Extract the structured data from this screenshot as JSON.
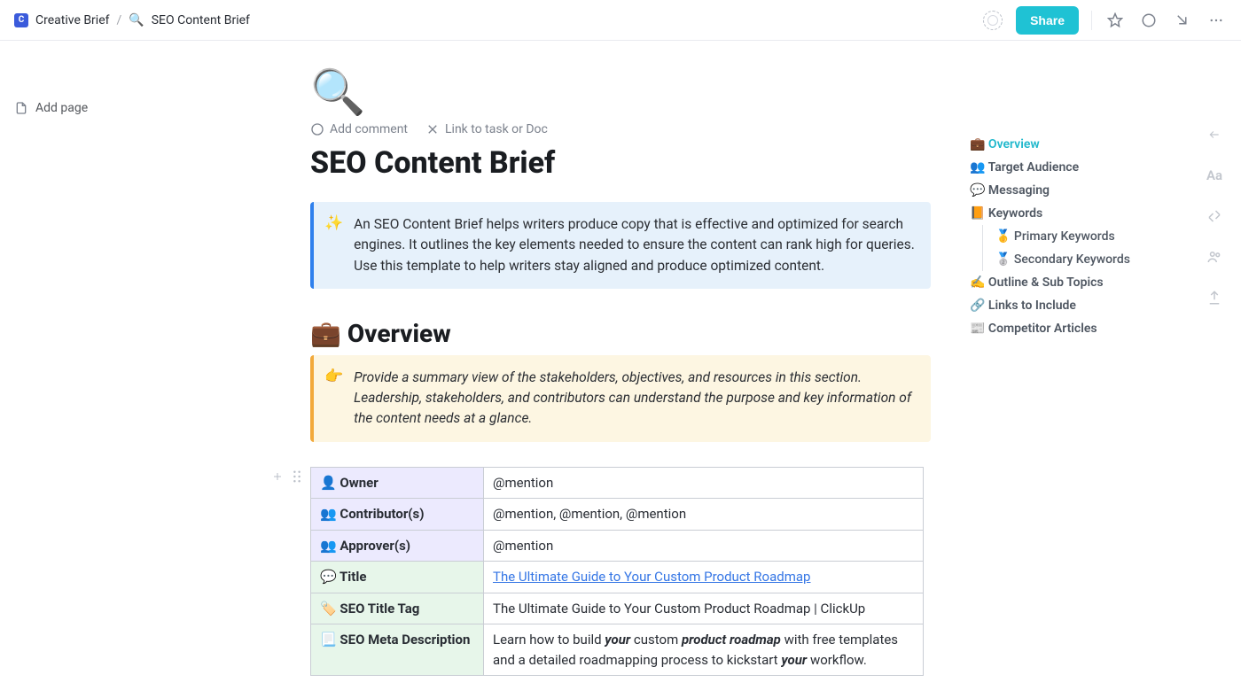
{
  "breadcrumb": {
    "workspace_initial": "C",
    "workspace": "Creative Brief",
    "separator": "/",
    "page_icon": "🔍",
    "page_name": "SEO Content Brief"
  },
  "topbar": {
    "share_label": "Share"
  },
  "left_rail": {
    "add_page_label": "Add page"
  },
  "page": {
    "icon": "🔍",
    "add_comment_label": "Add comment",
    "link_label": "Link to task or Doc",
    "title": "SEO Content Brief",
    "intro_callout_icon": "✨",
    "intro_callout": "An SEO Content Brief helps writers produce copy that is effective and optimized for search engines. It outlines the key elements needed to ensure the content can rank high for queries. Use this template to help writers stay aligned and produce optimized content.",
    "overview_heading_icon": "💼",
    "overview_heading": "Overview",
    "overview_callout_icon": "👉",
    "overview_callout": "Provide a summary view of the stakeholders, objectives, and resources in this section. Leadership, stakeholders, and contributors can understand the purpose and key information of the content needs at a glance."
  },
  "table": {
    "rows": [
      {
        "icon": "👤",
        "label": "Owner",
        "value": "@mention",
        "group": "purple"
      },
      {
        "icon": "👥",
        "label": "Contributor(s)",
        "value": "@mention, @mention, @mention",
        "group": "purple"
      },
      {
        "icon": "👥",
        "label": "Approver(s)",
        "value": "@mention",
        "group": "purple"
      },
      {
        "icon": "💬",
        "label": "Title",
        "value_link": "The Ultimate Guide to Your Custom Product Roadmap",
        "group": "green"
      },
      {
        "icon": "🏷️",
        "label": "SEO Title Tag",
        "value": "The Ultimate Guide to Your Custom Product Roadmap | ClickUp",
        "group": "green"
      },
      {
        "icon": "📃",
        "label": "SEO Meta Description",
        "value_parts": [
          {
            "t": "Learn how to build "
          },
          {
            "t": "your",
            "i": true,
            "b": true
          },
          {
            "t": " custom "
          },
          {
            "t": "product roadmap",
            "i": true,
            "b": true
          },
          {
            "t": " with free templates and a detailed roadmapping process to kickstart "
          },
          {
            "t": "your",
            "i": true,
            "b": true
          },
          {
            "t": " workflow."
          }
        ],
        "group": "green"
      }
    ]
  },
  "toc": {
    "items": [
      {
        "icon": "💼",
        "label": "Overview",
        "active": true
      },
      {
        "icon": "👥",
        "label": "Target Audience"
      },
      {
        "icon": "💬",
        "label": "Messaging"
      },
      {
        "icon": "📙",
        "label": "Keywords",
        "children": [
          {
            "icon": "🥇",
            "label": "Primary Keywords"
          },
          {
            "icon": "🥈",
            "label": "Secondary Keywords"
          }
        ]
      },
      {
        "icon": "✍️",
        "label": "Outline & Sub Topics"
      },
      {
        "icon": "🔗",
        "label": "Links to Include"
      },
      {
        "icon": "📰",
        "label": "Competitor Articles"
      }
    ]
  },
  "float_rail": {
    "font_label": "Aa"
  }
}
